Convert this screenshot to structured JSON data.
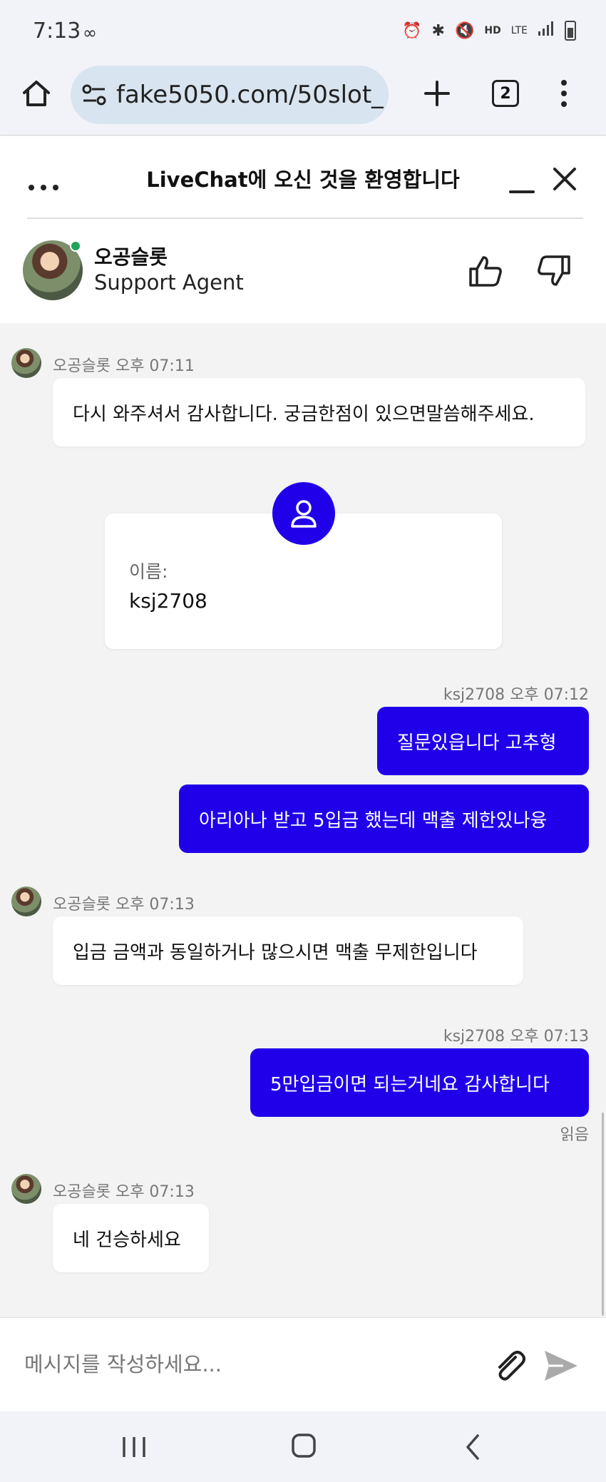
{
  "status_bar": {
    "time": "7:13",
    "icons": [
      "infinity-icon",
      "alarm-icon",
      "bluetooth-icon",
      "mute-icon",
      "hd-voice-icon",
      "lte-icon",
      "signal-icon",
      "battery-icon"
    ],
    "hd_label": "HD",
    "lte_label": "LTE"
  },
  "browser": {
    "url": "fake5050.com/50slot_",
    "tab_count": "2"
  },
  "chat_header": {
    "title": "LiveChat에 오신 것을 환영합니다",
    "agent_name": "오공슬롯",
    "agent_role": "Support Agent"
  },
  "messages": [
    {
      "from": "agent",
      "meta": "오공슬롯 오후 07:11",
      "text": "다시 와주셔서 감사합니다. 궁금한점이 있으면말씀해주세요."
    },
    {
      "card": {
        "label": "이름:",
        "value": "ksj2708"
      }
    },
    {
      "from": "user",
      "meta": "ksj2708 오후 07:12",
      "text": "질문있읍니다 고추형"
    },
    {
      "from": "user",
      "text": "아리아나 받고 5입금 했는데 맥출 제한있나융"
    },
    {
      "from": "agent",
      "meta": "오공슬롯 오후 07:13",
      "text": "입금 금액과 동일하거나 많으시면 맥출 무제한입니다"
    },
    {
      "from": "user",
      "meta": "ksj2708 오후 07:13",
      "text": "5만입금이면 되는거네요 감사합니다",
      "status": "읽음"
    },
    {
      "from": "agent",
      "meta": "오공슬롯 오후 07:13",
      "text": "네 건승하세요"
    }
  ],
  "composer": {
    "placeholder": "메시지를 작성하세요..."
  },
  "colors": {
    "accent": "#2000e8",
    "online": "#21a35a",
    "url_pill": "#d8e4ef"
  }
}
